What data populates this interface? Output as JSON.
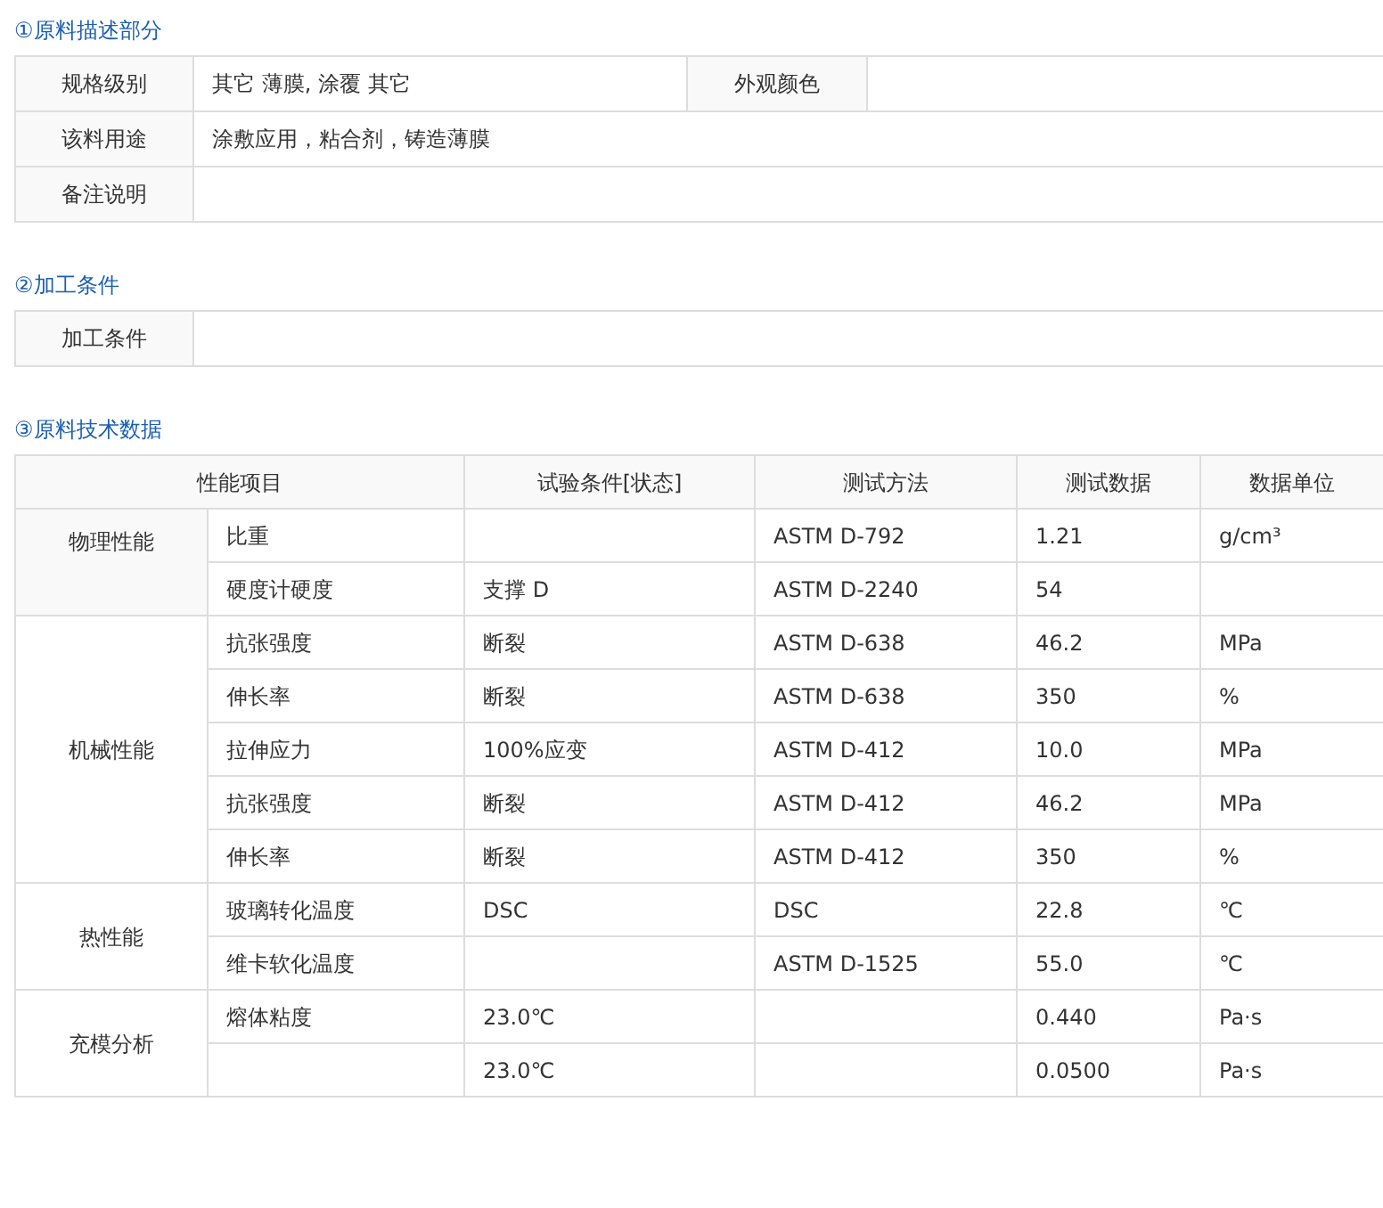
{
  "description_section": {
    "title": "①原料描述部分",
    "rows": [
      {
        "fields": [
          {
            "label": "规格级别",
            "value": "其它 薄膜, 涂覆 其它"
          },
          {
            "label": "外观颜色"
          }
        ]
      },
      {
        "fields": [
          {
            "label": "该料用途",
            "value": "涂敷应用，粘合剂，铸造薄膜"
          }
        ]
      },
      {
        "fields": [
          {
            "label": "备注说明"
          }
        ]
      }
    ]
  },
  "processing_section": {
    "title": "②加工条件",
    "rows": [
      {
        "fields": [
          {
            "label": "加工条件"
          }
        ]
      }
    ]
  },
  "technical_section": {
    "title": "③原料技术数据",
    "columns": [
      "性能项目",
      "试验条件[状态]",
      "测试方法",
      "测试数据",
      "数据单位"
    ],
    "groups": [
      {
        "name": "物理性能",
        "shaded": true,
        "rows": [
          {
            "item": "比重",
            "method": "ASTM D-792",
            "value": "1.21",
            "unit": "g/cm³"
          },
          {
            "item": "硬度计硬度",
            "condition": "支撑 D",
            "method": "ASTM D-2240",
            "value": "54"
          }
        ]
      },
      {
        "name": "机械性能",
        "shaded": false,
        "rows": [
          {
            "item": "抗张强度",
            "condition": "断裂",
            "method": "ASTM D-638",
            "value": "46.2",
            "unit": "MPa"
          },
          {
            "item": "伸长率",
            "condition": "断裂",
            "method": "ASTM D-638",
            "value": "350",
            "unit": "%"
          },
          {
            "item": "拉伸应力",
            "condition": "100%应变",
            "method": "ASTM D-412",
            "value": "10.0",
            "unit": "MPa"
          },
          {
            "item": "抗张强度",
            "condition": "断裂",
            "method": "ASTM D-412",
            "value": "46.2",
            "unit": "MPa"
          },
          {
            "item": "伸长率",
            "condition": "断裂",
            "method": "ASTM D-412",
            "value": "350",
            "unit": "%"
          }
        ]
      },
      {
        "name": "热性能",
        "shaded": false,
        "rows": [
          {
            "item": "玻璃转化温度",
            "condition": "DSC",
            "method": "DSC",
            "value": "22.8",
            "unit": "℃"
          },
          {
            "item": "维卡软化温度",
            "method": "ASTM D-1525",
            "value": "55.0",
            "unit": "℃"
          }
        ]
      },
      {
        "name": "充模分析",
        "shaded": false,
        "rows": [
          {
            "item": "熔体粘度",
            "condition": "23.0℃",
            "value": "0.440",
            "unit": "Pa·s"
          },
          {
            "condition": "23.0℃",
            "value": "0.0500",
            "unit": "Pa·s"
          }
        ]
      }
    ]
  }
}
